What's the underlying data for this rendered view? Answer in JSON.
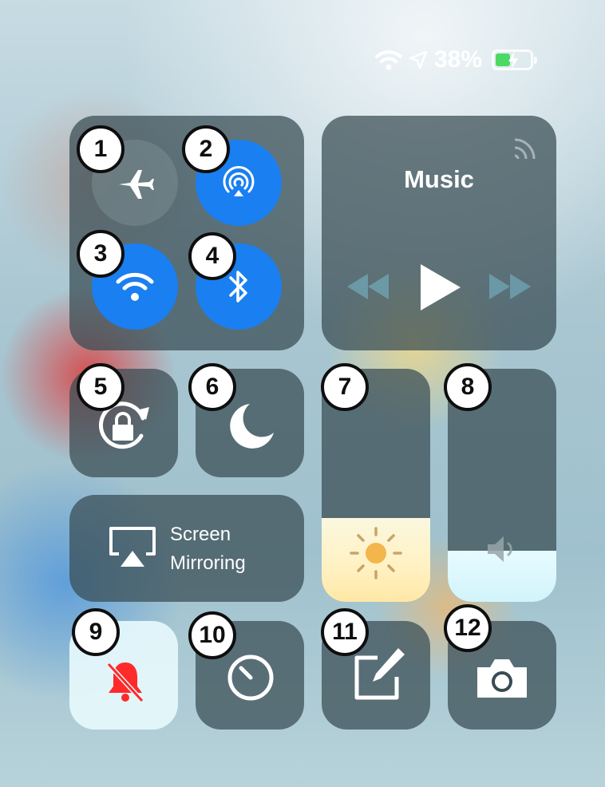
{
  "status_bar": {
    "wifi_icon": "wifi-icon",
    "location_icon": "location-arrow-icon",
    "battery_percent": "38%",
    "battery_level": 0.38,
    "battery_charging": true
  },
  "connectivity": {
    "airplane": {
      "icon": "airplane-icon",
      "active": false,
      "badge": "1"
    },
    "airdrop": {
      "icon": "airdrop-icon",
      "active": true,
      "badge": "2"
    },
    "wifi": {
      "icon": "wifi-icon",
      "active": true,
      "badge": "3"
    },
    "bluetooth": {
      "icon": "bluetooth-icon",
      "active": true,
      "badge": "4"
    }
  },
  "music": {
    "title": "Music",
    "icons": [
      "airplay-audio-icon",
      "rewind-icon",
      "play-icon",
      "fast-forward-icon"
    ]
  },
  "toggles": {
    "rotation_lock": {
      "icon": "rotation-lock-icon",
      "badge": "5"
    },
    "do_not_disturb": {
      "icon": "moon-icon",
      "badge": "6"
    }
  },
  "sliders": {
    "brightness": {
      "icon": "sun-icon",
      "badge": "7",
      "level": 0.36
    },
    "volume": {
      "icon": "speaker-icon",
      "badge": "8",
      "level": 0.22
    }
  },
  "screen_mirroring": {
    "line1": "Screen",
    "line2": "Mirroring",
    "icon": "airplay-screen-icon"
  },
  "bottom_row": {
    "silent": {
      "icon": "muted-bell-icon",
      "badge": "9"
    },
    "timer": {
      "icon": "timer-icon",
      "badge": "10"
    },
    "notes": {
      "icon": "notes-icon",
      "badge": "11"
    },
    "camera": {
      "icon": "camera-icon",
      "badge": "12"
    }
  },
  "colors": {
    "accent_blue": "#1a7ff0",
    "battery_green": "#4cd964",
    "silent_red": "#ff2a2a",
    "badge_border": "#0e0e0e"
  }
}
